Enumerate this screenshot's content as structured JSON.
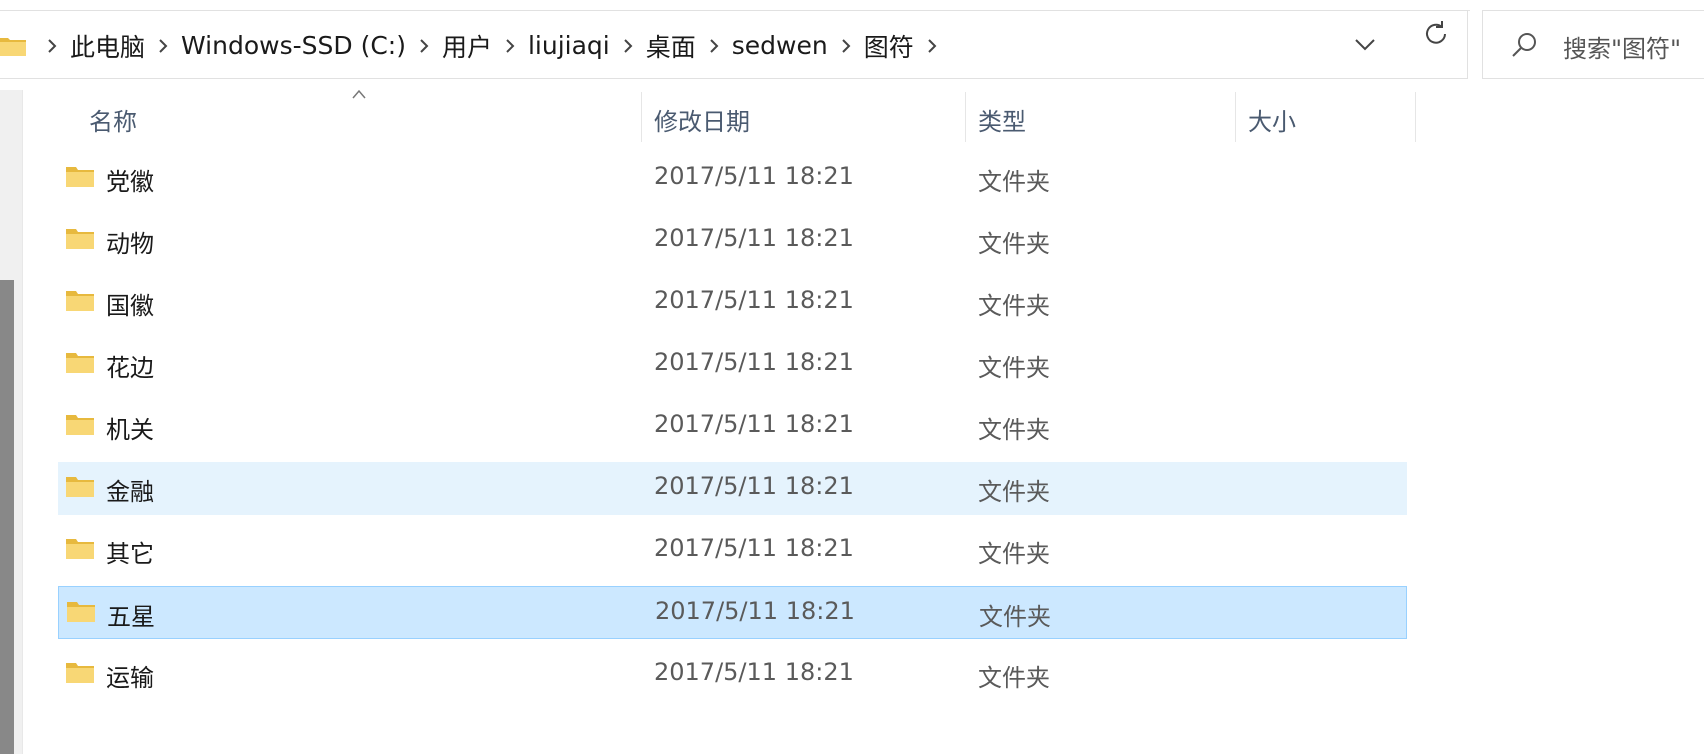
{
  "address_bar": {
    "breadcrumbs": [
      "此电脑",
      "Windows-SSD (C:)",
      "用户",
      "liujiaqi",
      "桌面",
      "sedwen",
      "图符"
    ]
  },
  "search": {
    "placeholder": "搜索\"图符\""
  },
  "columns": {
    "name": "名称",
    "modified": "修改日期",
    "type": "类型",
    "size": "大小"
  },
  "files": [
    {
      "name": "党徽",
      "modified": "2017/5/11 18:21",
      "type": "文件夹",
      "state": ""
    },
    {
      "name": "动物",
      "modified": "2017/5/11 18:21",
      "type": "文件夹",
      "state": ""
    },
    {
      "name": "国徽",
      "modified": "2017/5/11 18:21",
      "type": "文件夹",
      "state": ""
    },
    {
      "name": "花边",
      "modified": "2017/5/11 18:21",
      "type": "文件夹",
      "state": ""
    },
    {
      "name": "机关",
      "modified": "2017/5/11 18:21",
      "type": "文件夹",
      "state": ""
    },
    {
      "name": "金融",
      "modified": "2017/5/11 18:21",
      "type": "文件夹",
      "state": "hover"
    },
    {
      "name": "其它",
      "modified": "2017/5/11 18:21",
      "type": "文件夹",
      "state": ""
    },
    {
      "name": "五星",
      "modified": "2017/5/11 18:21",
      "type": "文件夹",
      "state": "selected"
    },
    {
      "name": "运输",
      "modified": "2017/5/11 18:21",
      "type": "文件夹",
      "state": ""
    }
  ],
  "colors": {
    "selected_bg": "#cce8ff",
    "selected_border": "#99d1ff",
    "hover_bg": "#e5f3fd",
    "folder_yellow": "#f8d775",
    "header_text": "#4a5a70"
  },
  "icons": {
    "address_folder": "folder-icon",
    "breadcrumb_separator": "chevron-right-icon",
    "address_dropdown": "chevron-down-icon",
    "refresh": "refresh-icon",
    "search": "search-icon",
    "sort": "sort-up-icon",
    "file_folder": "folder-icon"
  }
}
